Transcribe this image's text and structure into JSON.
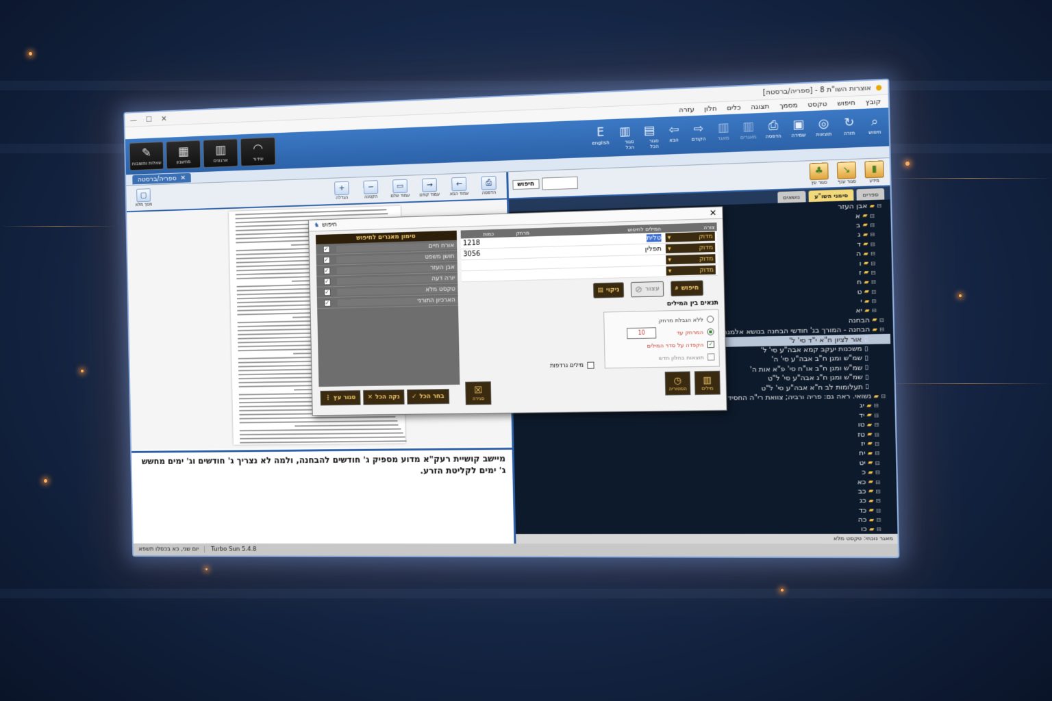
{
  "window": {
    "title": "אוצרות השו\"ת 8 - [ספריה/ברסטה]"
  },
  "menu": [
    "קובץ",
    "חיפוש",
    "טקסט",
    "מסמך",
    "תצוגה",
    "כלים",
    "חלון",
    "עזרה"
  ],
  "ribbon": [
    {
      "icon": "search-icon",
      "label": "חיפוש",
      "dim": false
    },
    {
      "icon": "redo-icon",
      "label": "חזרה",
      "dim": false
    },
    {
      "icon": "target-icon",
      "label": "תוצאות",
      "dim": false
    },
    {
      "icon": "save-icon",
      "label": "שמירה",
      "dim": false
    },
    {
      "icon": "print-icon",
      "label": "הדפסה",
      "dim": false
    },
    {
      "icon": "books-icon",
      "label": "מאגרים",
      "dim": true
    },
    {
      "icon": "books-icon",
      "label": "מאגר",
      "dim": true
    },
    {
      "icon": "arrow-right-icon",
      "label": "הקודם",
      "dim": false
    },
    {
      "icon": "arrow-left-icon",
      "label": "הבא",
      "dim": false
    },
    {
      "icon": "book-icon",
      "label": "סגור הכל",
      "dim": false
    },
    {
      "icon": "books-icon",
      "label": "סגור הכל",
      "dim": false
    },
    {
      "icon": "english-icon",
      "label": "english",
      "dim": false
    }
  ],
  "big_tabs": [
    {
      "icon": "feather-icon",
      "label": "שאלות ותשובות"
    },
    {
      "icon": "barcode-icon",
      "label": "מחשבון"
    },
    {
      "icon": "books-icon",
      "label": "ארגונים"
    },
    {
      "icon": "kippah-icon",
      "label": "שידור"
    }
  ],
  "doc_tab": {
    "label": "ספריה/ברסטה"
  },
  "left_toolbar": [
    {
      "label": "הגדלה",
      "glyph": "+"
    },
    {
      "label": "הקטנה",
      "glyph": "−"
    },
    {
      "label": "עמוד שלם",
      "glyph": "▭"
    },
    {
      "label": "עמוד קודם",
      "glyph": "→"
    },
    {
      "label": "עמוד הבא",
      "glyph": "←"
    },
    {
      "label": "הדפסה",
      "glyph": "⎙"
    }
  ],
  "fullscreen_label": "מסך מלא",
  "excerpt": "מיישב קושיית רעק\"א מדוע מספיק ג' חודשים להבחנה, ולמה לא נצריך ג' חודשים וג' ימים מחשש ג' ימים לקליטת הזרע.",
  "right_toolbar": [
    {
      "label": "מידע",
      "glyph": "▮"
    },
    {
      "label": "סגור ענף",
      "glyph": "↘"
    },
    {
      "label": "סגור עץ",
      "glyph": "♣"
    }
  ],
  "search": {
    "label": "חיפוש",
    "value": ""
  },
  "right_tabs": [
    {
      "label": "ספרים",
      "active": false
    },
    {
      "label": "סימני השו\"ע",
      "active": true
    },
    {
      "label": "נושאים",
      "active": false
    }
  ],
  "tree": [
    {
      "text": "אבן העזר",
      "type": "folder",
      "sel": false
    },
    {
      "text": "א",
      "type": "folder",
      "sel": false
    },
    {
      "text": "ב",
      "type": "folder",
      "sel": false
    },
    {
      "text": "ג",
      "type": "folder",
      "sel": false
    },
    {
      "text": "ד",
      "type": "folder",
      "sel": false
    },
    {
      "text": "ה",
      "type": "folder",
      "sel": false
    },
    {
      "text": "ו",
      "type": "folder",
      "sel": false
    },
    {
      "text": "ז",
      "type": "folder",
      "sel": false
    },
    {
      "text": "ח",
      "type": "folder",
      "sel": false
    },
    {
      "text": "ט",
      "type": "folder",
      "sel": false
    },
    {
      "text": "י",
      "type": "folder",
      "sel": false
    },
    {
      "text": "יא",
      "type": "folder",
      "sel": false
    },
    {
      "text": "הבחנה",
      "type": "folder",
      "sel": false
    },
    {
      "text": "הבחנה - המורך בג' חודשי הבחנה בנושא אלמנה",
      "type": "folder",
      "sel": false
    },
    {
      "text": "אור לציון ח\"א י\"ד סי' ל'",
      "type": "doc",
      "sel": true
    },
    {
      "text": "משכנות יעקב קמא אבה\"ע סי' ל'",
      "type": "doc",
      "sel": false
    },
    {
      "text": "שמ\"ש ומגן ח\"ב אבה\"ע סי' ה'",
      "type": "doc",
      "sel": false
    },
    {
      "text": "שמ\"ש ומגן ח\"ב או\"ח סי' פ\"א אות ה'",
      "type": "doc",
      "sel": false
    },
    {
      "text": "שמ\"ש ומגן ח\"ג אבה\"ע סי' ל\"ט",
      "type": "doc",
      "sel": false
    },
    {
      "text": "תעלומות לב ח\"א אבה\"ע סי' ל\"ט",
      "type": "doc",
      "sel": false
    },
    {
      "text": "נשואי. ראה גם: פריה ורביה; צוואת רי\"ה החסיד",
      "type": "folder",
      "sel": false
    },
    {
      "text": "יג",
      "type": "folder",
      "sel": false
    },
    {
      "text": "יד",
      "type": "folder",
      "sel": false
    },
    {
      "text": "טו",
      "type": "folder",
      "sel": false
    },
    {
      "text": "טז",
      "type": "folder",
      "sel": false
    },
    {
      "text": "יז",
      "type": "folder",
      "sel": false
    },
    {
      "text": "יח",
      "type": "folder",
      "sel": false
    },
    {
      "text": "יט",
      "type": "folder",
      "sel": false
    },
    {
      "text": "כ",
      "type": "folder",
      "sel": false
    },
    {
      "text": "כא",
      "type": "folder",
      "sel": false
    },
    {
      "text": "כב",
      "type": "folder",
      "sel": false
    },
    {
      "text": "כג",
      "type": "folder",
      "sel": false
    },
    {
      "text": "כד",
      "type": "folder",
      "sel": false
    },
    {
      "text": "כה",
      "type": "folder",
      "sel": false
    },
    {
      "text": "כו",
      "type": "folder",
      "sel": false
    }
  ],
  "right_status": "מאגר נוכחי: טקסט מלא",
  "status": {
    "left": "יום שני, כא בכסלו תשפא",
    "version": "Turbo Sun 5.4.8"
  },
  "dialog": {
    "title": "חיפוש",
    "grid_headers": {
      "form": "צורה",
      "words": "המילים לחיפוש",
      "distance": "מרחק",
      "count": "כמות"
    },
    "rows": [
      {
        "form": "מדוק",
        "word": "טלית",
        "highlight": true,
        "distance": "",
        "count": "1218"
      },
      {
        "form": "מדוק",
        "word": "תפלין",
        "highlight": false,
        "distance": "",
        "count": "3056"
      },
      {
        "form": "מדוק",
        "word": "",
        "highlight": false,
        "distance": "",
        "count": ""
      },
      {
        "form": "מדוק",
        "word": "",
        "highlight": false,
        "distance": "",
        "count": ""
      }
    ],
    "buttons": {
      "search": "חיפוש",
      "stop": "עצור",
      "clear": "ניקוי"
    },
    "conditions_title": "תנאים בין המילים",
    "opt_no_limit": "ללא הגבלת מרחק",
    "opt_distance": "המרחק עד",
    "distance_value": "10",
    "opt_order": "הקפדה על סדר המילים",
    "opt_new": "תוצאות בחלון חדש",
    "synonyms": "מילים נרדפות",
    "words_btn": "מילים",
    "history_btn": "הסטוריה",
    "sources_title": "סימון מאגרים לחיפוש",
    "sources": [
      "אורח חיים",
      "חושן משפט",
      "אבן העזר",
      "יורה דעה",
      "טקסט מלא",
      "הארכיון התורני"
    ],
    "close_btn": "סגירה",
    "select_all": "בחר הכל",
    "clear_all": "נקה הכל",
    "close_tree": "סגור עץ"
  }
}
